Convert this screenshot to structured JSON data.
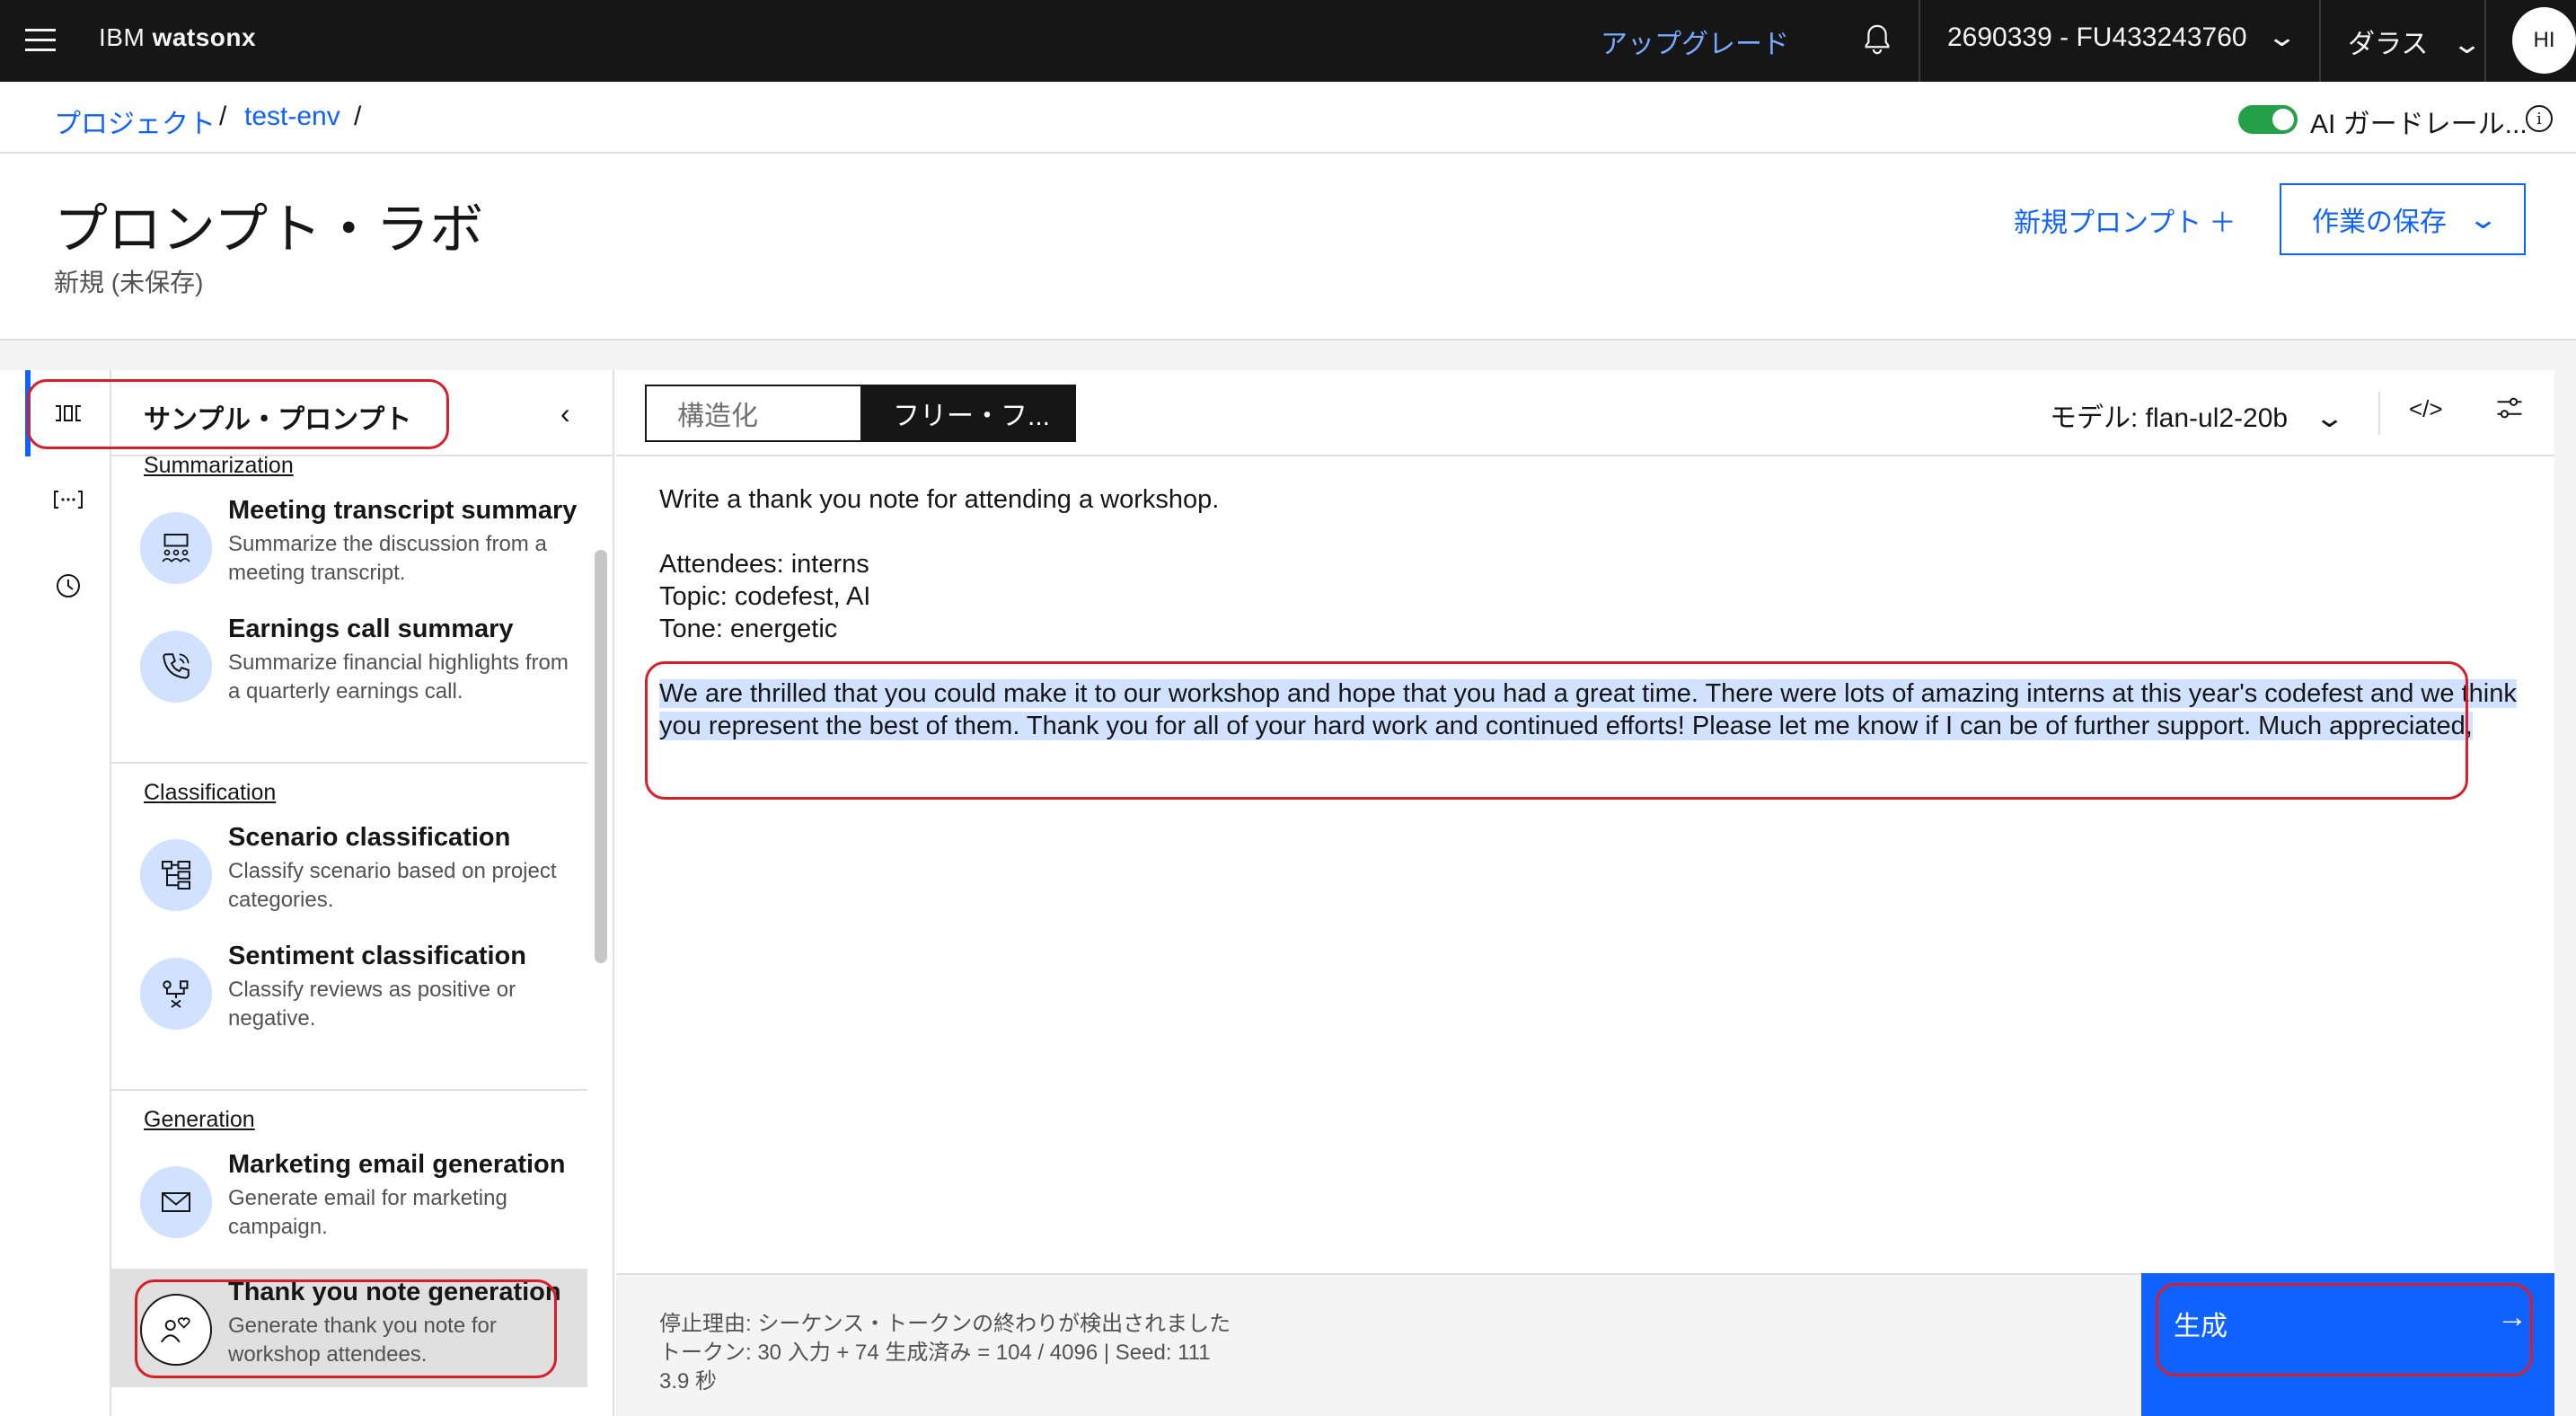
{
  "topbar": {
    "brand_prefix": "IBM",
    "brand_name": "watsonx",
    "upgrade": "アップグレード",
    "account": "2690339 - FU433243760",
    "region": "ダラス",
    "avatar": "HI"
  },
  "breadcrumb": {
    "items": [
      "プロジェクト",
      "test-env"
    ],
    "separator": "/",
    "guardrail_label": "AI ガードレール...",
    "guardrail_on": true
  },
  "header": {
    "title": "プロンプト・ラボ",
    "subtitle": "新規 (未保存)",
    "new_prompt": "新規プロンプト ＋",
    "save_work": "作業の保存"
  },
  "sample_panel": {
    "title": "サンプル・プロンプト",
    "sections": [
      {
        "label": "Summarization",
        "items": [
          {
            "title": "Meeting transcript summary",
            "desc": "Summarize the discussion from a meeting transcript.",
            "icon": "meeting-icon"
          },
          {
            "title": "Earnings call summary",
            "desc": "Summarize financial highlights from a quarterly earnings call.",
            "icon": "phone-icon"
          }
        ]
      },
      {
        "label": "Classification",
        "items": [
          {
            "title": "Scenario classification",
            "desc": "Classify scenario based on project categories.",
            "icon": "tree-icon"
          },
          {
            "title": "Sentiment classification",
            "desc": "Classify reviews as positive or negative.",
            "icon": "sentiment-icon"
          }
        ]
      },
      {
        "label": "Generation",
        "items": [
          {
            "title": "Marketing email generation",
            "desc": "Generate email for marketing campaign.",
            "icon": "email-icon"
          },
          {
            "title": "Thank you note generation",
            "desc": "Generate thank you note for workshop attendees.",
            "icon": "user-heart-icon",
            "selected": true
          }
        ]
      }
    ]
  },
  "editor": {
    "mode_structured": "構造化",
    "mode_freeform": "フリー・フ...",
    "model_label": "モデル: flan-ul2-20b",
    "prompt_lines": [
      "Write a thank you note for attending a workshop.",
      "",
      "Attendees: interns",
      "Topic: codefest, AI",
      "Tone: energetic"
    ],
    "generated_text": "We are thrilled that you could make it to our workshop and hope that you had a great time. There were lots of amazing interns at this year's codefest and we think you represent the best of them. Thank you for all of your hard work and continued efforts! Please let me know if I can be of further support. Much appreciated,"
  },
  "footer": {
    "stop_reason": "停止理由: シーケンス・トークンの終わりが検出されました",
    "tokens": "トークン: 30 入力 + 74 生成済み = 104 / 4096 | Seed: 111",
    "time": "3.9 秒"
  },
  "generate_button": {
    "label": "生成",
    "arrow": "→"
  },
  "colors": {
    "accent": "#0f62fe",
    "topbar_bg": "#161616",
    "highlight": "#d0e2ff",
    "annotation_red": "#da1e28",
    "toggle_green": "#24a148"
  }
}
